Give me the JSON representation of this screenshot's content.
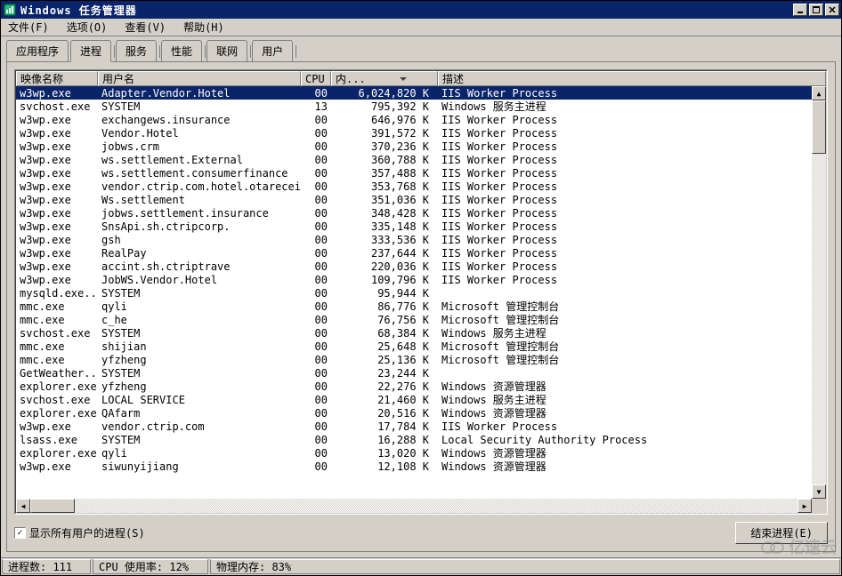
{
  "window": {
    "title": "Windows 任务管理器"
  },
  "menu": {
    "file": "文件(F)",
    "options": "选项(O)",
    "view": "查看(V)",
    "help": "帮助(H)"
  },
  "tabs": {
    "applications": "应用程序",
    "processes": "进程",
    "services": "服务",
    "performance": "性能",
    "networking": "联网",
    "users": "用户"
  },
  "columns": {
    "image_name": "映像名称",
    "user_name": "用户名",
    "cpu": "CPU",
    "memory": "内...",
    "description": "描述"
  },
  "processes": [
    {
      "img": "w3wp.exe",
      "user": "Adapter.Vendor.Hotel",
      "cpu": "00",
      "mem": "6,024,820 K",
      "desc": "IIS Worker Process",
      "selected": true
    },
    {
      "img": "svchost.exe",
      "user": "SYSTEM",
      "cpu": "13",
      "mem": "795,392 K",
      "desc": "Windows 服务主进程"
    },
    {
      "img": "w3wp.exe",
      "user": "exchangews.insurance",
      "cpu": "00",
      "mem": "646,976 K",
      "desc": "IIS Worker Process"
    },
    {
      "img": "w3wp.exe",
      "user": "Vendor.Hotel",
      "cpu": "00",
      "mem": "391,572 K",
      "desc": "IIS Worker Process"
    },
    {
      "img": "w3wp.exe",
      "user": "jobws.crm",
      "cpu": "00",
      "mem": "370,236 K",
      "desc": "IIS Worker Process"
    },
    {
      "img": "w3wp.exe",
      "user": "ws.settlement.External",
      "cpu": "00",
      "mem": "360,788 K",
      "desc": "IIS Worker Process"
    },
    {
      "img": "w3wp.exe",
      "user": "ws.settlement.consumerfinance",
      "cpu": "00",
      "mem": "357,488 K",
      "desc": "IIS Worker Process"
    },
    {
      "img": "w3wp.exe",
      "user": "vendor.ctrip.com.hotel.otareceive",
      "cpu": "00",
      "mem": "353,768 K",
      "desc": "IIS Worker Process"
    },
    {
      "img": "w3wp.exe",
      "user": "Ws.settlement",
      "cpu": "00",
      "mem": "351,036 K",
      "desc": "IIS Worker Process"
    },
    {
      "img": "w3wp.exe",
      "user": "jobws.settlement.insurance",
      "cpu": "00",
      "mem": "348,428 K",
      "desc": "IIS Worker Process"
    },
    {
      "img": "w3wp.exe",
      "user": "SnsApi.sh.ctripcorp.",
      "cpu": "00",
      "mem": "335,148 K",
      "desc": "IIS Worker Process"
    },
    {
      "img": "w3wp.exe",
      "user": "gsh",
      "cpu": "00",
      "mem": "333,536 K",
      "desc": "IIS Worker Process"
    },
    {
      "img": "w3wp.exe",
      "user": "RealPay",
      "cpu": "00",
      "mem": "237,644 K",
      "desc": "IIS Worker Process"
    },
    {
      "img": "w3wp.exe",
      "user": "accint.sh.ctriptrave",
      "cpu": "00",
      "mem": "220,036 K",
      "desc": "IIS Worker Process"
    },
    {
      "img": "w3wp.exe",
      "user": "JobWS.Vendor.Hotel",
      "cpu": "00",
      "mem": "109,796 K",
      "desc": "IIS Worker Process"
    },
    {
      "img": "mysqld.exe...",
      "user": "SYSTEM",
      "cpu": "00",
      "mem": "95,944 K",
      "desc": ""
    },
    {
      "img": "mmc.exe",
      "user": "qyli",
      "cpu": "00",
      "mem": "86,776 K",
      "desc": "Microsoft 管理控制台"
    },
    {
      "img": "mmc.exe",
      "user": "c_he",
      "cpu": "00",
      "mem": "76,756 K",
      "desc": "Microsoft 管理控制台"
    },
    {
      "img": "svchost.exe",
      "user": "SYSTEM",
      "cpu": "00",
      "mem": "68,384 K",
      "desc": "Windows 服务主进程"
    },
    {
      "img": "mmc.exe",
      "user": "shijian",
      "cpu": "00",
      "mem": "25,648 K",
      "desc": "Microsoft 管理控制台"
    },
    {
      "img": "mmc.exe",
      "user": "yfzheng",
      "cpu": "00",
      "mem": "25,136 K",
      "desc": "Microsoft 管理控制台"
    },
    {
      "img": "GetWeather...",
      "user": "SYSTEM",
      "cpu": "00",
      "mem": "23,244 K",
      "desc": ""
    },
    {
      "img": "explorer.exe",
      "user": "yfzheng",
      "cpu": "00",
      "mem": "22,276 K",
      "desc": "Windows 资源管理器"
    },
    {
      "img": "svchost.exe",
      "user": "LOCAL SERVICE",
      "cpu": "00",
      "mem": "21,460 K",
      "desc": "Windows 服务主进程"
    },
    {
      "img": "explorer.exe",
      "user": "QAfarm",
      "cpu": "00",
      "mem": "20,516 K",
      "desc": "Windows 资源管理器"
    },
    {
      "img": "w3wp.exe",
      "user": "vendor.ctrip.com",
      "cpu": "00",
      "mem": "17,784 K",
      "desc": "IIS Worker Process"
    },
    {
      "img": "lsass.exe",
      "user": "SYSTEM",
      "cpu": "00",
      "mem": "16,288 K",
      "desc": "Local Security Authority Process"
    },
    {
      "img": "explorer.exe",
      "user": "qyli",
      "cpu": "00",
      "mem": "13,020 K",
      "desc": "Windows 资源管理器"
    },
    {
      "img": "w3wp.exe",
      "user": "siwunyijiang",
      "cpu": "00",
      "mem": "12,108 K",
      "desc": "Windows 资源管理器"
    }
  ],
  "controls": {
    "show_all_users": "显示所有用户的进程(S)",
    "end_process": "结束进程(E)"
  },
  "status": {
    "processes": "进程数: 111",
    "cpu_usage": "CPU 使用率: 12%",
    "phys_mem": "物理内存: 83%"
  },
  "watermark": "亿速云"
}
